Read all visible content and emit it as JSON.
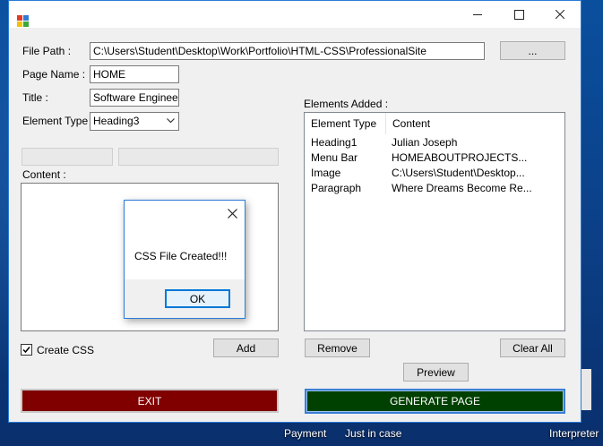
{
  "form": {
    "file_path_label": "File Path :",
    "file_path_value": "C:\\Users\\Student\\Desktop\\Work\\Portfolio\\HTML-CSS\\ProfessionalSite",
    "browse_label": "...",
    "page_name_label": "Page Name :",
    "page_name_value": "HOME",
    "title_label": "Title :",
    "title_value": "Software Engineer",
    "element_type_label": "Element Type :",
    "element_type_value": "Heading3",
    "content_label": "Content :",
    "create_css_label": "Create CSS",
    "create_css_checked": true,
    "add_label": "Add",
    "exit_label": "EXIT"
  },
  "elements": {
    "label": "Elements Added :",
    "columns": [
      "Element Type",
      "Content"
    ],
    "rows": [
      {
        "type": "Heading1",
        "content": "Julian Joseph"
      },
      {
        "type": "Menu Bar",
        "content": "HOMEABOUTPROJECTS..."
      },
      {
        "type": "Image",
        "content": "C:\\Users\\Student\\Desktop..."
      },
      {
        "type": "Paragraph",
        "content": "Where Dreams Become Re..."
      }
    ],
    "remove_label": "Remove",
    "clear_all_label": "Clear All",
    "preview_label": "Preview",
    "generate_label": "GENERATE PAGE"
  },
  "dialog": {
    "message": "CSS File Created!!!",
    "ok_label": "OK"
  },
  "desktop": {
    "items": [
      "Payment",
      "Just in case",
      "Interpreter"
    ]
  },
  "colors": {
    "exit_bg": "#800000",
    "generate_bg": "#004000",
    "window_border": "#2b7bd6",
    "desktop_bg": "#0b3f86"
  }
}
